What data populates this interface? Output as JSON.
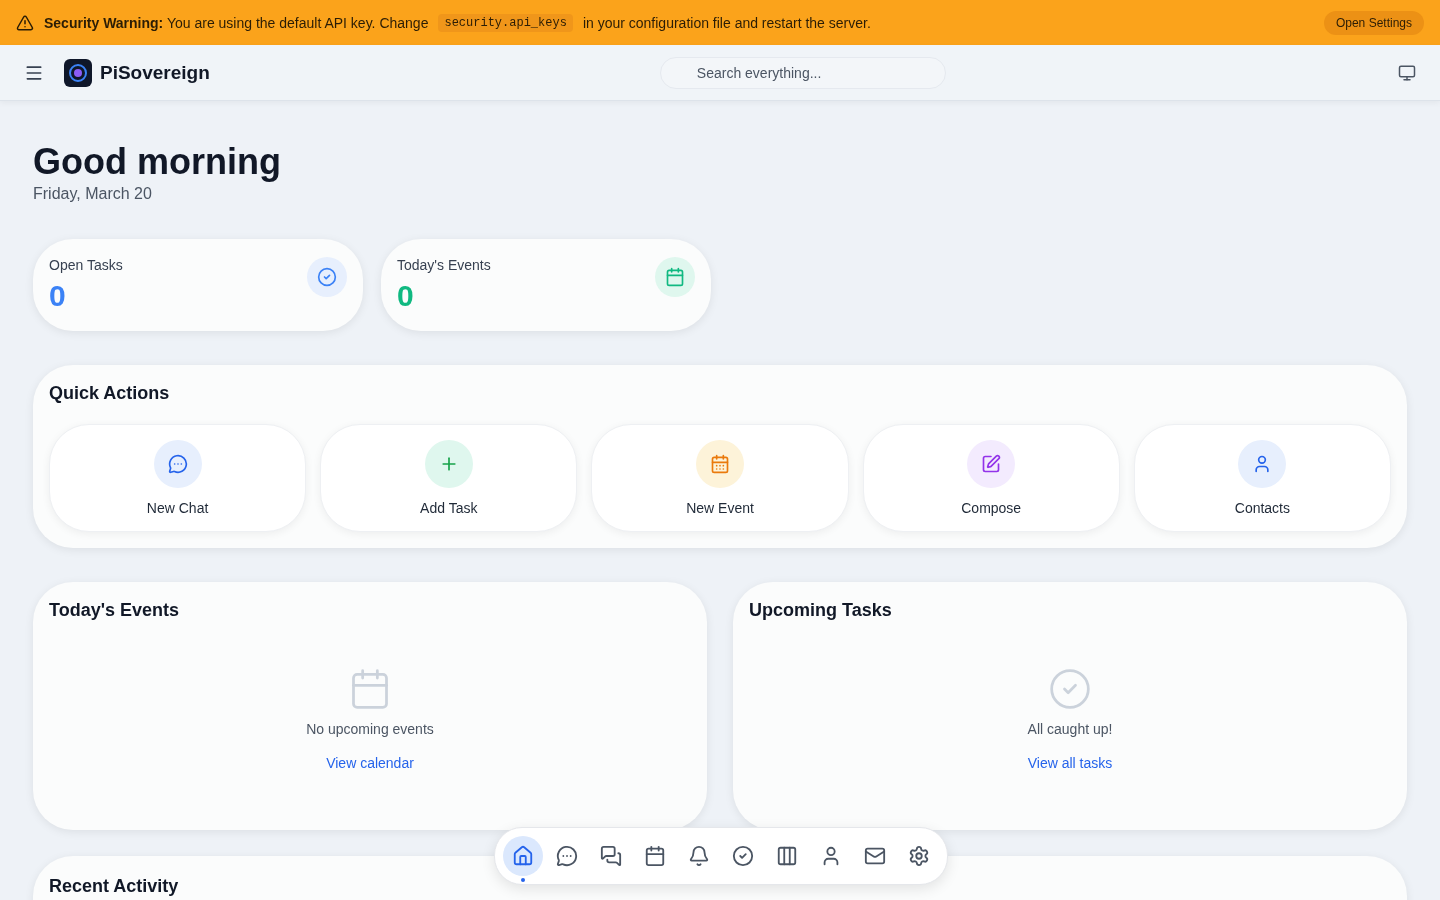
{
  "banner": {
    "message_start": "**Security Warning:** You are using the default API key. Change",
    "config_key": "security.api_keys",
    "message_end": "in your configuration file and restart the server.",
    "button": "Open Settings"
  },
  "header": {
    "app_name": "PiSovereign",
    "search": {
      "placeholder": "Search everything..."
    }
  },
  "greeting": {
    "title": "Good morning",
    "date": "Friday, March 20"
  },
  "stats": [
    {
      "kind": "tasks",
      "label": "Open Tasks",
      "value": "0"
    },
    {
      "kind": "events",
      "label": "Today's Events",
      "value": "0"
    }
  ],
  "quick_actions": {
    "title": "Quick Actions",
    "items": [
      {
        "kind": "chat",
        "label": "New Chat"
      },
      {
        "kind": "task",
        "label": "Add Task"
      },
      {
        "kind": "event",
        "label": "New Event"
      },
      {
        "kind": "compose",
        "label": "Compose"
      },
      {
        "kind": "contacts",
        "label": "Contacts"
      }
    ]
  },
  "panels": [
    {
      "kind": "events",
      "title": "Today's Events",
      "empty_text": "No upcoming events",
      "link": "View calendar"
    },
    {
      "kind": "tasks",
      "title": "Upcoming Tasks",
      "empty_text": "All caught up!",
      "link": "View all tasks"
    }
  ],
  "recent_activity": {
    "title": "Recent Activity"
  },
  "dock": [
    {
      "kind": "home",
      "selected": true
    },
    {
      "kind": "chat",
      "selected": false
    },
    {
      "kind": "messages",
      "selected": false
    },
    {
      "kind": "calendar",
      "selected": false
    },
    {
      "kind": "bell",
      "selected": false
    },
    {
      "kind": "check",
      "selected": false
    },
    {
      "kind": "columns",
      "selected": false
    },
    {
      "kind": "user",
      "selected": false
    },
    {
      "kind": "mail",
      "selected": false
    },
    {
      "kind": "settings",
      "selected": false
    }
  ]
}
